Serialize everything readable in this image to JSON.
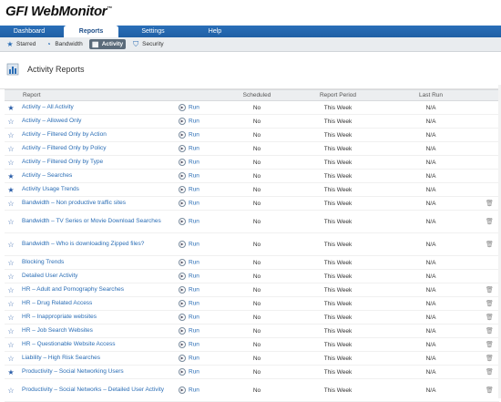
{
  "app": {
    "logo": "GFI WebMonitor",
    "logo_mark": "™"
  },
  "main_tabs": [
    {
      "label": "Dashboard",
      "active": false
    },
    {
      "label": "Reports",
      "active": true
    },
    {
      "label": "Settings",
      "active": false
    },
    {
      "label": "Help",
      "active": false
    }
  ],
  "sub_tabs": [
    {
      "label": "Starred",
      "icon": "star-icon",
      "active": false
    },
    {
      "label": "Bandwidth",
      "icon": "gauge-icon",
      "active": false
    },
    {
      "label": "Activity",
      "icon": "activity-icon",
      "active": true
    },
    {
      "label": "Security",
      "icon": "shield-icon",
      "active": false
    }
  ],
  "page": {
    "title": "Activity Reports",
    "icon": "chart-icon"
  },
  "table": {
    "headers": {
      "report": "Report",
      "scheduled": "Scheduled",
      "period": "Report Period",
      "lastrun": "Last Run"
    },
    "run_label": "Run",
    "rows": [
      {
        "name": "Activity – All Activity",
        "starred": true,
        "scheduled": "No",
        "period": "This Week",
        "lastrun": "N/A",
        "deletable": false,
        "lines": 1
      },
      {
        "name": "Activity – Allowed Only",
        "starred": false,
        "scheduled": "No",
        "period": "This Week",
        "lastrun": "N/A",
        "deletable": false,
        "lines": 1
      },
      {
        "name": "Activity – Filtered Only by Action",
        "starred": false,
        "scheduled": "No",
        "period": "This Week",
        "lastrun": "N/A",
        "deletable": false,
        "lines": 1
      },
      {
        "name": "Activity – Filtered Only by Policy",
        "starred": false,
        "scheduled": "No",
        "period": "This Week",
        "lastrun": "N/A",
        "deletable": false,
        "lines": 1
      },
      {
        "name": "Activity – Filtered Only by Type",
        "starred": false,
        "scheduled": "No",
        "period": "This Week",
        "lastrun": "N/A",
        "deletable": false,
        "lines": 1
      },
      {
        "name": "Activity – Searches",
        "starred": true,
        "scheduled": "No",
        "period": "This Week",
        "lastrun": "N/A",
        "deletable": false,
        "lines": 1
      },
      {
        "name": "Activity Usage Trends",
        "starred": true,
        "scheduled": "No",
        "period": "This Week",
        "lastrun": "N/A",
        "deletable": false,
        "lines": 1
      },
      {
        "name": "Bandwidth – Non productive traffic sites",
        "starred": false,
        "scheduled": "No",
        "period": "This Week",
        "lastrun": "N/A",
        "deletable": true,
        "lines": 1
      },
      {
        "name": "Bandwidth – TV Series or Movie Download Searches",
        "starred": false,
        "scheduled": "No",
        "period": "This Week",
        "lastrun": "N/A",
        "deletable": true,
        "lines": 2
      },
      {
        "name": "Bandwidth – Who is downloading Zipped files?",
        "starred": false,
        "scheduled": "No",
        "period": "This Week",
        "lastrun": "N/A",
        "deletable": true,
        "lines": 2
      },
      {
        "name": "Blocking Trends",
        "starred": false,
        "scheduled": "No",
        "period": "This Week",
        "lastrun": "N/A",
        "deletable": false,
        "lines": 1
      },
      {
        "name": "Detailed User Activity",
        "starred": false,
        "scheduled": "No",
        "period": "This Week",
        "lastrun": "N/A",
        "deletable": false,
        "lines": 1
      },
      {
        "name": "HR – Adult and Pornography Searches",
        "starred": false,
        "scheduled": "No",
        "period": "This Week",
        "lastrun": "N/A",
        "deletable": true,
        "lines": 1
      },
      {
        "name": "HR – Drug Related Access",
        "starred": false,
        "scheduled": "No",
        "period": "This Week",
        "lastrun": "N/A",
        "deletable": true,
        "lines": 1
      },
      {
        "name": "HR – Inappropriate websites",
        "starred": false,
        "scheduled": "No",
        "period": "This Week",
        "lastrun": "N/A",
        "deletable": true,
        "lines": 1
      },
      {
        "name": "HR – Job Search Websites",
        "starred": false,
        "scheduled": "No",
        "period": "This Week",
        "lastrun": "N/A",
        "deletable": true,
        "lines": 1
      },
      {
        "name": "HR – Questionable Website Access",
        "starred": false,
        "scheduled": "No",
        "period": "This Week",
        "lastrun": "N/A",
        "deletable": true,
        "lines": 1
      },
      {
        "name": "Liability – High Risk Searches",
        "starred": false,
        "scheduled": "No",
        "period": "This Week",
        "lastrun": "N/A",
        "deletable": true,
        "lines": 1
      },
      {
        "name": "Productivity – Social Networking Users",
        "starred": true,
        "scheduled": "No",
        "period": "This Week",
        "lastrun": "N/A",
        "deletable": true,
        "lines": 1
      },
      {
        "name": "Productivity – Social Networks – Detailed User Activity",
        "starred": false,
        "scheduled": "No",
        "period": "This Week",
        "lastrun": "N/A",
        "deletable": true,
        "lines": 2
      }
    ]
  },
  "colors": {
    "nav_bg": "#1f5fa5",
    "link": "#2a6db5",
    "active_subtab": "#5b6b7a"
  }
}
